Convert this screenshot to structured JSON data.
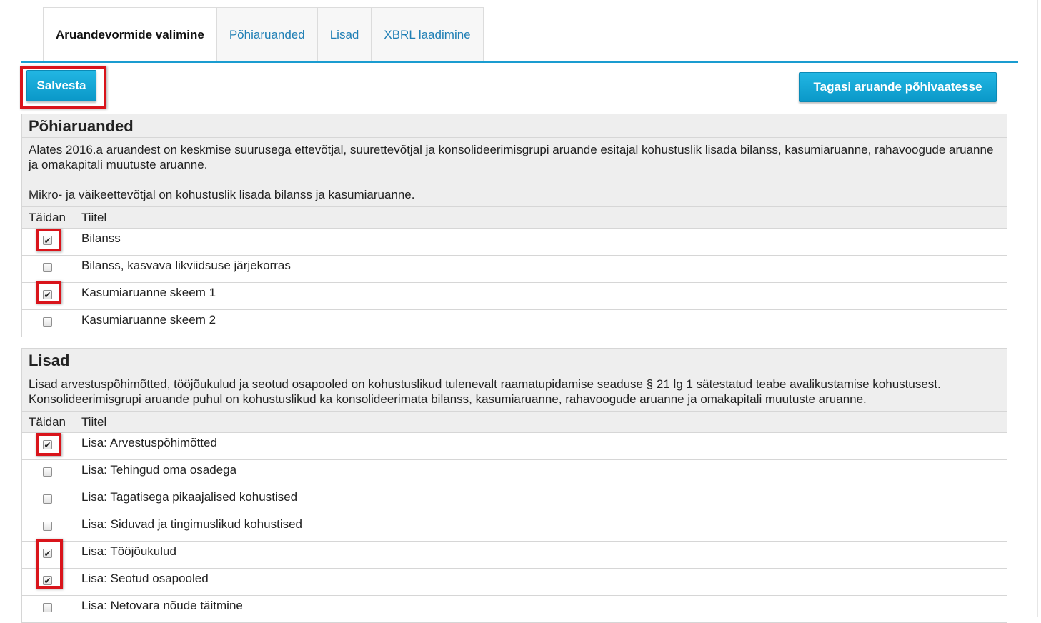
{
  "tabs": [
    {
      "label": "Aruandevormide valimine",
      "active": true
    },
    {
      "label": "Põhiaruanded",
      "active": false
    },
    {
      "label": "Lisad",
      "active": false
    },
    {
      "label": "XBRL laadimine",
      "active": false
    }
  ],
  "buttons": {
    "save_label": "Salvesta",
    "back_label": "Tagasi aruande põhivaatesse"
  },
  "colors": {
    "accent": "#1a9cd0",
    "highlight": "#d9141b",
    "link": "#1f7fb5"
  },
  "sections": [
    {
      "title": "Põhiaruanded",
      "description": [
        "Alates 2016.a aruandest on keskmise suurusega ettevõtjal, suurettevõtjal ja konsolideerimisgrupi aruande esitajal kohustuslik lisada bilanss, kasumiaruanne, rahavoogude aruanne ja omakapitali muutuste aruanne.",
        "Mikro- ja väikeettevõtjal on kohustuslik lisada bilanss ja kasumiaruanne."
      ],
      "col_fill": "Täidan",
      "col_title": "Tiitel",
      "rows": [
        {
          "title": "Bilanss",
          "checked": true
        },
        {
          "title": "Bilanss, kasvava likviidsuse järjekorras",
          "checked": false
        },
        {
          "title": "Kasumiaruanne skeem 1",
          "checked": true
        },
        {
          "title": "Kasumiaruanne skeem 2",
          "checked": false
        }
      ]
    },
    {
      "title": "Lisad",
      "description": [
        "Lisad arvestuspõhimõtted, tööjõukulud ja seotud osapooled on kohustuslikud tulenevalt raamatupidamise seaduse § 21 lg 1 sätestatud teabe avalikustamise kohustusest. Konsolideerimisgrupi aruande puhul on kohustuslikud ka konsolideerimata bilanss, kasumiaruanne, rahavoogude aruanne ja omakapitali muutuste aruanne."
      ],
      "col_fill": "Täidan",
      "col_title": "Tiitel",
      "rows": [
        {
          "title": "Lisa: Arvestuspõhimõtted",
          "checked": true
        },
        {
          "title": "Lisa: Tehingud oma osadega",
          "checked": false
        },
        {
          "title": "Lisa: Tagatisega pikaajalised kohustised",
          "checked": false
        },
        {
          "title": "Lisa: Siduvad ja tingimuslikud kohustised",
          "checked": false
        },
        {
          "title": "Lisa: Tööjõukulud",
          "checked": true
        },
        {
          "title": "Lisa: Seotud osapooled",
          "checked": true
        },
        {
          "title": "Lisa: Netovara nõude täitmine",
          "checked": false
        }
      ]
    }
  ]
}
